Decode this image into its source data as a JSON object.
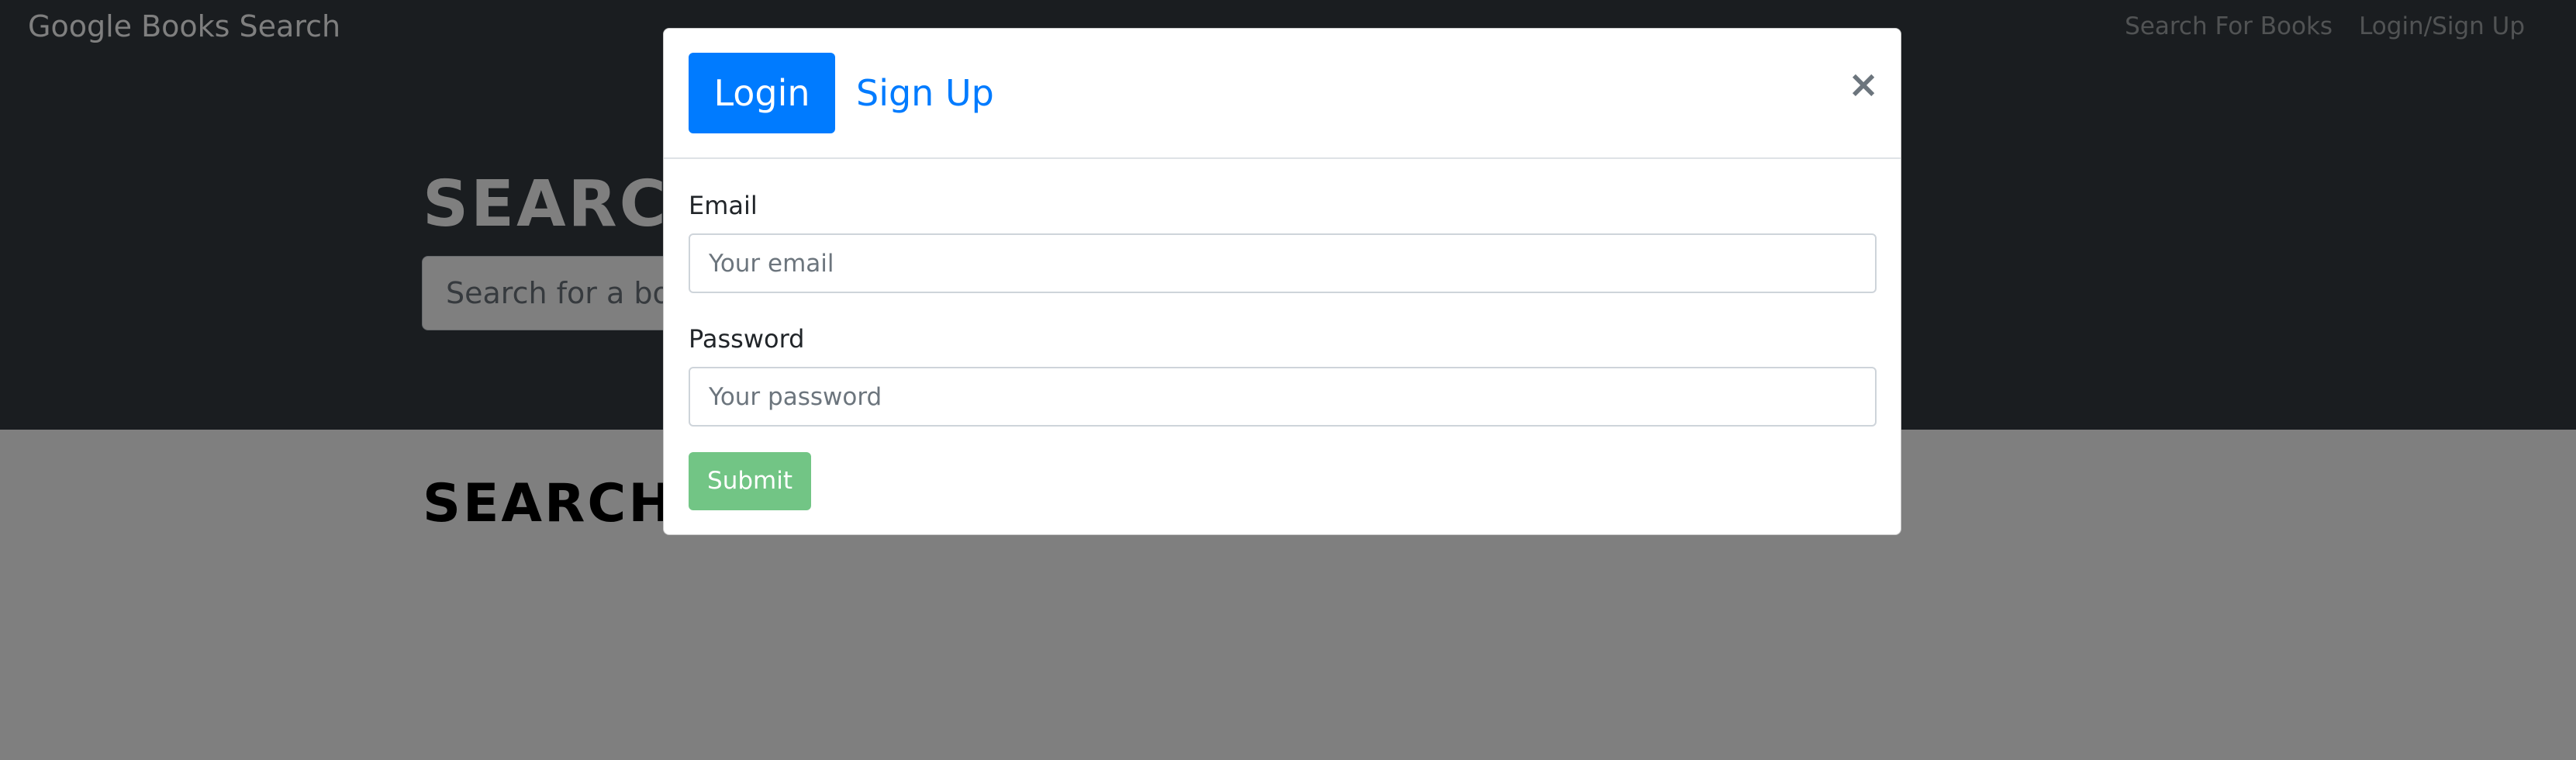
{
  "navbar": {
    "brand": "Google Books Search",
    "links": [
      "Search For Books",
      "Login/Sign Up"
    ]
  },
  "hero": {
    "title": "SEARCH FOR BOOKS!",
    "search_placeholder": "Search for a book"
  },
  "results": {
    "title": "SEARCH FOR A BOOK TO BEGIN"
  },
  "modal": {
    "tabs": {
      "login": "Login",
      "signup": "Sign Up",
      "active": "Login"
    },
    "close_symbol": "×",
    "email": {
      "label": "Email",
      "placeholder": "Your email",
      "value": ""
    },
    "password": {
      "label": "Password",
      "placeholder": "Your password",
      "value": ""
    },
    "submit_label": "Submit"
  },
  "colors": {
    "hero_bg": "#343a40",
    "primary": "#007bff",
    "submit": "#28a745",
    "backdrop": "rgba(0,0,0,0.5)"
  },
  "icons": {
    "close": "close-icon"
  }
}
